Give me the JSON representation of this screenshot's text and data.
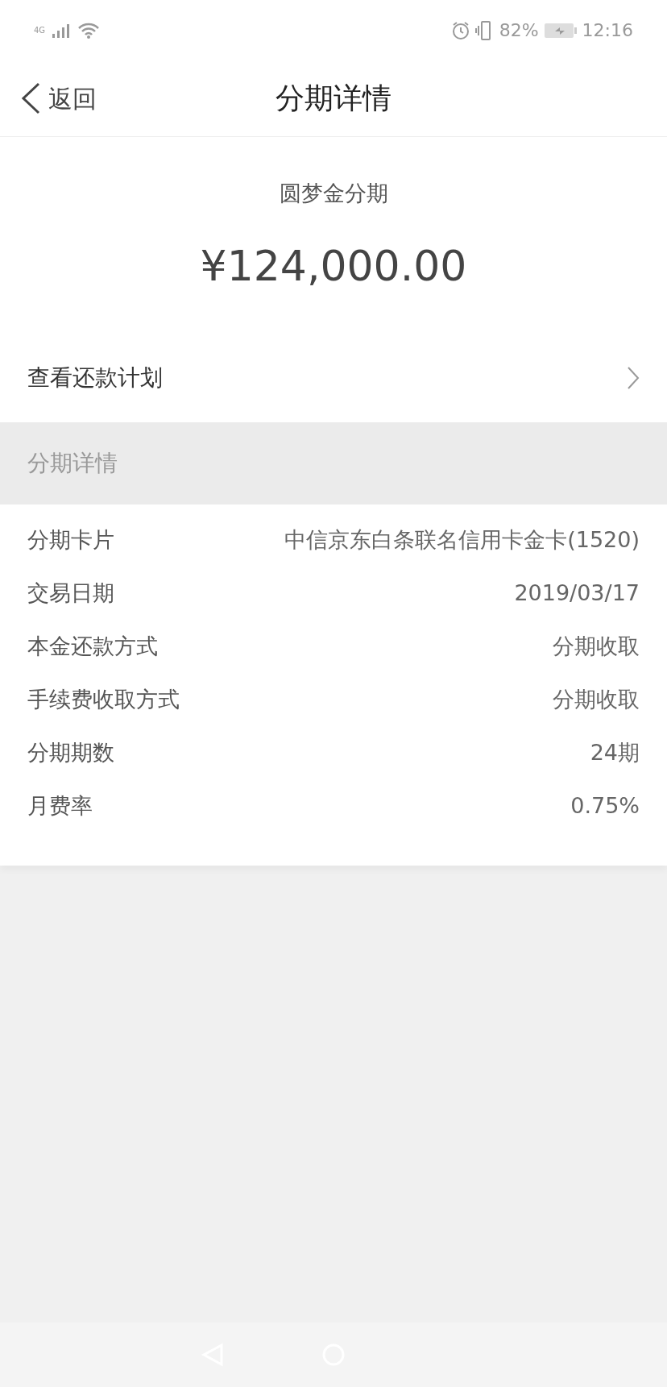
{
  "status_bar": {
    "network": "4G",
    "battery": "82%",
    "time": "12:16"
  },
  "header": {
    "back": "返回",
    "title": "分期详情"
  },
  "summary": {
    "product": "圆梦金分期",
    "amount": "¥124,000.00",
    "link": "查看还款计划"
  },
  "section_title": "分期详情",
  "details": [
    {
      "label": "分期卡片",
      "value": "中信京东白条联名信用卡金卡(1520)"
    },
    {
      "label": "交易日期",
      "value": "2019/03/17"
    },
    {
      "label": "本金还款方式",
      "value": "分期收取"
    },
    {
      "label": "手续费收取方式",
      "value": "分期收取"
    },
    {
      "label": "分期期数",
      "value": "24期"
    },
    {
      "label": "月费率",
      "value": "0.75%"
    }
  ]
}
